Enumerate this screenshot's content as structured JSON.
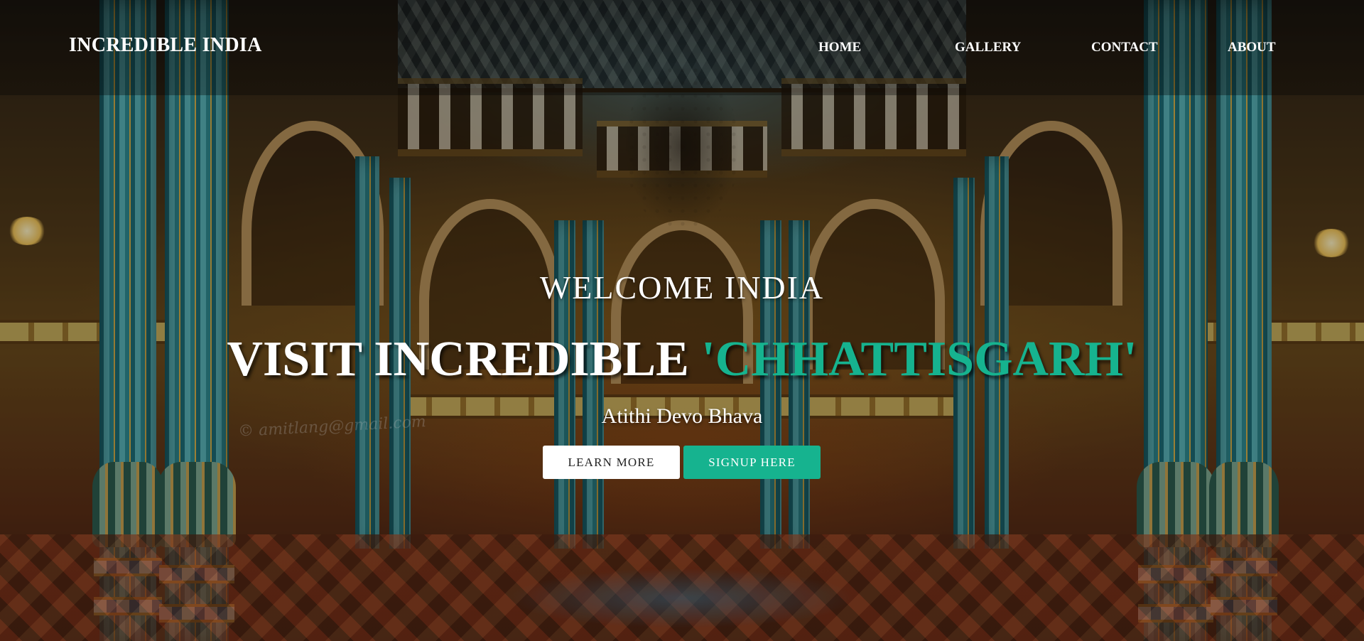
{
  "brand": {
    "logo_text": "INCREDIBLE INDIA"
  },
  "nav": {
    "items": [
      {
        "label": "HOME"
      },
      {
        "label": "GALLERY"
      },
      {
        "label": "CONTACT"
      },
      {
        "label": "ABOUT"
      }
    ]
  },
  "hero": {
    "welcome": "WELCOME INDIA",
    "headline_prefix": "VISIT INCREDIBLE",
    "headline_highlight": "'CHHATTISGARH'",
    "tagline": "Atithi Devo Bhava",
    "primary_button": "LEARN MORE",
    "secondary_button": "SIGNUP HERE",
    "accent_color": "#16b38f",
    "background_watermark": "© amitlang@gmail.com"
  }
}
